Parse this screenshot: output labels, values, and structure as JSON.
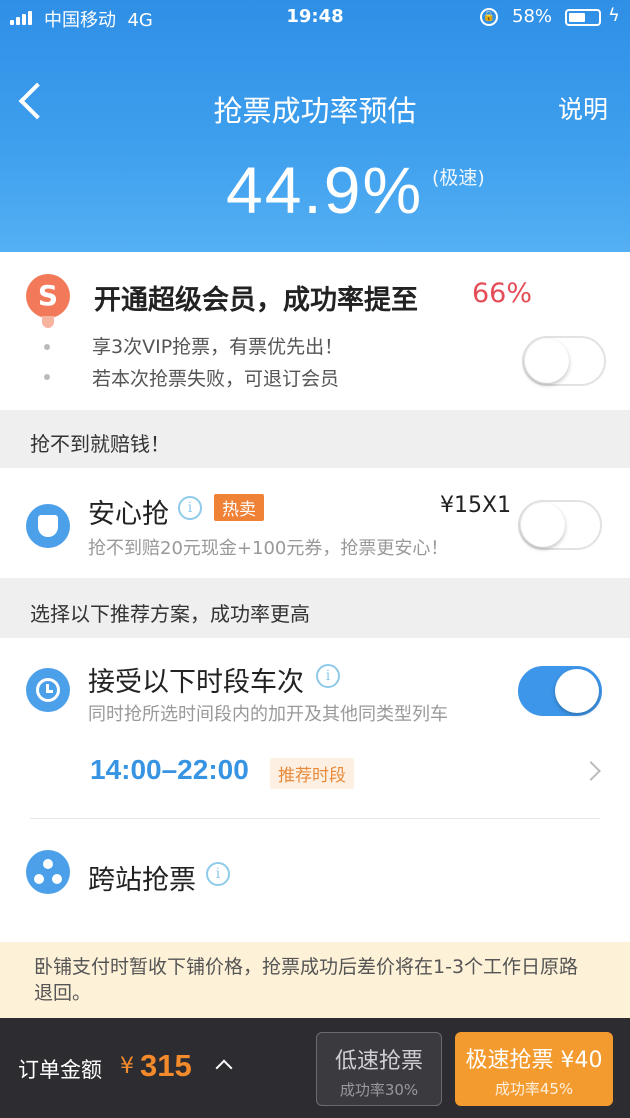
{
  "status_bar": {
    "carrier": "中国移动",
    "network": "4G",
    "time": "19:48",
    "battery": "58%"
  },
  "header": {
    "title": "抢票成功率预估",
    "help": "说明",
    "rate": "44.9%",
    "rate_mode": "(极速)"
  },
  "vip": {
    "title": "开通超级会员，成功率提至",
    "rate": "66%",
    "benefits": [
      "享3次VIP抢票，有票优先出！",
      "若本次抢票失败，可退订会员"
    ],
    "enabled": false
  },
  "compensation_label": "抢不到就赔钱！",
  "anxin": {
    "title": "安心抢",
    "badge": "热卖",
    "price": "¥15X1",
    "subtitle": "抢不到赔20元现金+100元券，抢票更安心！",
    "enabled": false
  },
  "recommend_label": "选择以下推荐方案，成功率更高",
  "time_slot": {
    "title": "接受以下时段车次",
    "subtitle": "同时抢所选时间段内的加开及其他同类型列车",
    "range": "14:00–22:00",
    "tag": "推荐时段",
    "enabled": true
  },
  "cross_station": {
    "title": "跨站抢票"
  },
  "notice": "卧铺支付时暂收下铺价格，抢票成功后差价将在1-3个工作日原路退回。",
  "footer": {
    "order_label": "订单金额",
    "currency": "¥",
    "amount": "315",
    "slow_button": {
      "label": "低速抢票",
      "rate": "成功率30%"
    },
    "fast_button": {
      "label": "极速抢票 ¥40",
      "rate": "成功率45%"
    }
  },
  "icons": [
    "back-icon",
    "s-badge-icon",
    "shield-icon",
    "info-icon",
    "clock-icon",
    "share-nodes-icon",
    "chevron-right-icon",
    "chevron-up-icon"
  ],
  "colors": {
    "primary": "#3d96e9",
    "accent": "#f39b2e",
    "rate_highlight": "#e44c57"
  }
}
